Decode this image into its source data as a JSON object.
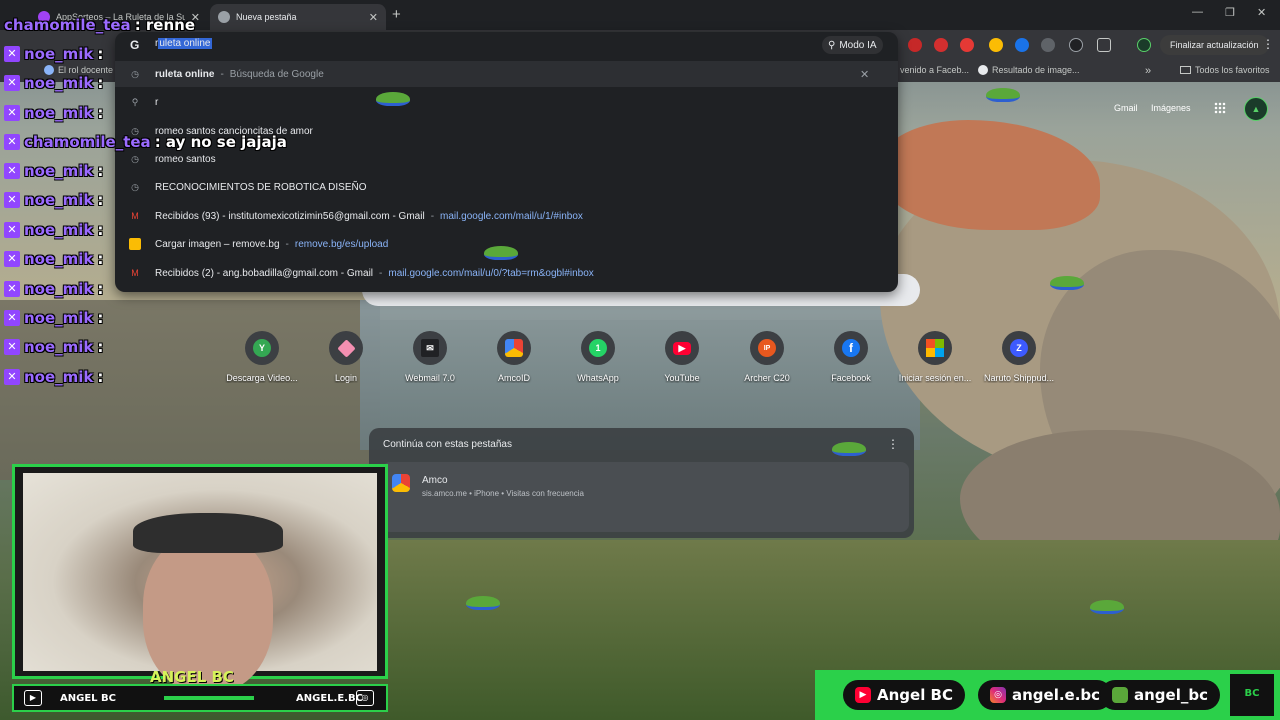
{
  "tabs": [
    {
      "title": "AppSorteos – La Ruleta de la Suerte"
    },
    {
      "title": "Nueva pestaña"
    }
  ],
  "toolbar": {
    "update_label": "Finalizar actualización"
  },
  "bookmarks": [
    {
      "label": "El rol docente"
    },
    {
      "label": "venido a Faceb..."
    },
    {
      "label": "Resultado de image..."
    },
    {
      "label": "Todos los favoritos"
    }
  ],
  "omnibox": {
    "typed_prefix": "r",
    "selected_text": "uleta online",
    "mode_ai_label": "Modo IA",
    "suggestions": [
      {
        "icon": "history-icon",
        "main": "ruleta online",
        "secondary": "Búsqueda de Google"
      },
      {
        "icon": "search-icon",
        "main": "r",
        "secondary": ""
      },
      {
        "icon": "history-icon",
        "main": "romeo santos cancioncitas de amor",
        "secondary": ""
      },
      {
        "icon": "history-icon",
        "main": "romeo santos",
        "secondary": ""
      },
      {
        "icon": "history-icon",
        "main": "RECONOCIMIENTOS DE ROBOTICA DISEÑO",
        "secondary": ""
      },
      {
        "icon": "gmail-icon",
        "main": "Recibidos (93) - institutomexicotizimin56@gmail.com - Gmail",
        "url": "mail.google.com/mail/u/1/#inbox"
      },
      {
        "icon": "removebg-icon",
        "main": "Cargar imagen – remove.bg",
        "url": "remove.bg/es/upload"
      },
      {
        "icon": "gmail-icon",
        "main": "Recibidos (2) - ang.bobadilla@gmail.com - Gmail",
        "url": "mail.google.com/mail/u/0/?tab=rm&ogbl#inbox"
      }
    ]
  },
  "ntp": {
    "gmail": "Gmail",
    "images": "Imágenes",
    "shortcuts": [
      {
        "name": "Descarga Video...",
        "letter": "Y",
        "color": "#34a853"
      },
      {
        "name": "Login",
        "letter": "",
        "color": "#f48fb1"
      },
      {
        "name": "Webmail 7.0",
        "letter": "",
        "color": "#202124"
      },
      {
        "name": "AmcoID",
        "letter": "",
        "color": "#fbbc04"
      },
      {
        "name": "WhatsApp",
        "letter": "1",
        "color": "#25d366"
      },
      {
        "name": "YouTube",
        "letter": "",
        "color": "#ff0033"
      },
      {
        "name": "Archer C20",
        "letter": "IP",
        "color": "#e8581f"
      },
      {
        "name": "Facebook",
        "letter": "f",
        "color": "#1877f2"
      },
      {
        "name": "Iniciar sesión en...",
        "letter": "",
        "color": "#f25022"
      },
      {
        "name": "Naruto Shippud...",
        "letter": "Z",
        "color": "#3d5afe"
      }
    ],
    "continue": {
      "header": "Continúa con estas pestañas",
      "item_title": "Amco",
      "item_meta": "sis.amco.me • iPhone • Visitas con frecuencia"
    }
  },
  "chat": [
    {
      "user": "chamomile_tea",
      "msg": ": renne"
    },
    {
      "user": "noe_mik",
      "msg": ":"
    },
    {
      "user": "noe_mik",
      "msg": ":"
    },
    {
      "user": "noe_mik",
      "msg": ":"
    },
    {
      "user": "chamomile_tea",
      "msg": ": ay no se jajaja"
    },
    {
      "user": "noe_mik",
      "msg": ":"
    },
    {
      "user": "noe_mik",
      "msg": ":"
    },
    {
      "user": "noe_mik",
      "msg": ":"
    },
    {
      "user": "noe_mik",
      "msg": ":"
    },
    {
      "user": "noe_mik",
      "msg": ":"
    },
    {
      "user": "noe_mik",
      "msg": ":"
    },
    {
      "user": "noe_mik",
      "msg": ":"
    },
    {
      "user": "noe_mik",
      "msg": ":"
    }
  ],
  "stream": {
    "streamer_name": "ANGEL BC",
    "bar_left": "ANGEL BC",
    "bar_right": "ANGEL.E.BC",
    "social_youtube": "Angel BC",
    "social_instagram": "angel.e.bc",
    "social_tiktok": "angel_bc",
    "logo": "BC"
  }
}
